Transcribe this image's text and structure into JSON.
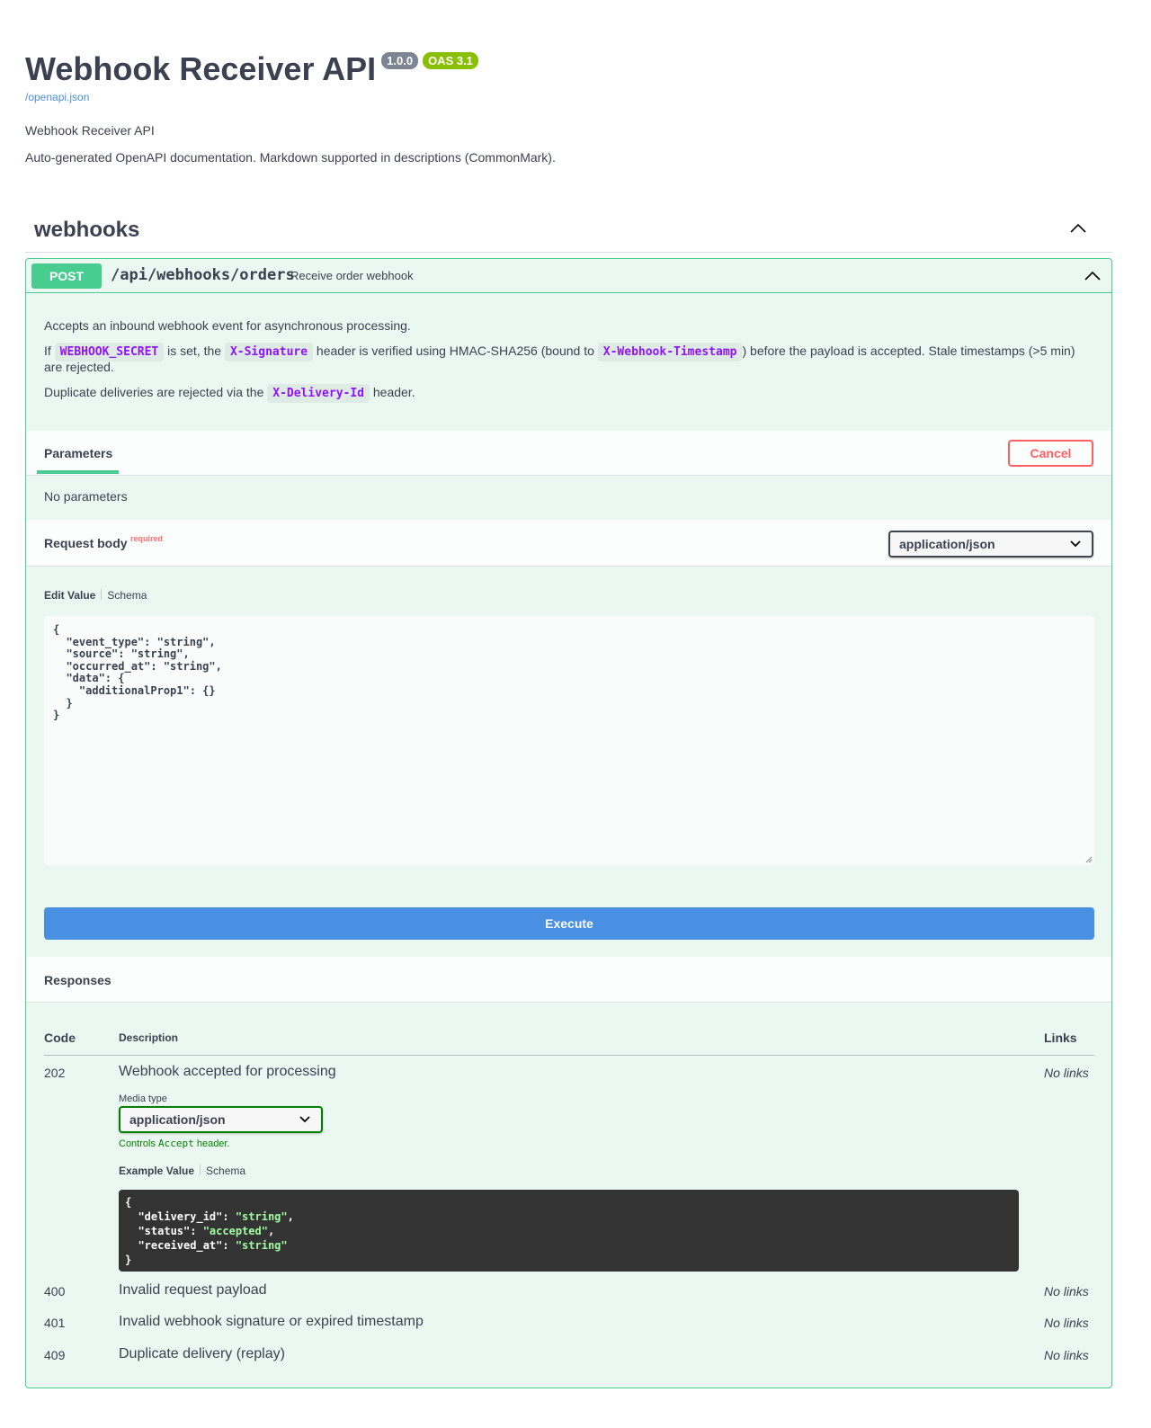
{
  "info": {
    "title": "Webhook Receiver API",
    "version": "1.0.0",
    "oas": "OAS 3.1",
    "spec_link": "/openapi.json",
    "description_1": "Webhook Receiver API",
    "description_2": "Auto-generated OpenAPI documentation. Markdown supported in descriptions (CommonMark)."
  },
  "tag": {
    "name": "webhooks",
    "chevron_icon": "chevron-up-icon"
  },
  "operation": {
    "method": "POST",
    "path": "/api/webhooks/orders",
    "summary": "Receive order webhook",
    "description": {
      "p1": "Accepts an inbound webhook event for asynchronous processing.",
      "p2_a": "If ",
      "p2_code1": "WEBHOOK_SECRET",
      "p2_b": " is set, the ",
      "p2_code2": "X-Signature",
      "p2_c": " header is verified using HMAC-SHA256 (bound to ",
      "p2_code3": "X-Webhook-Timestamp",
      "p2_d": ") before the payload is accepted. Stale timestamps (>5 min) are rejected.",
      "p3_a": "Duplicate deliveries are rejected via the ",
      "p3_code": "X-Delivery-Id",
      "p3_b": " header."
    },
    "parameters": {
      "tab_label": "Parameters",
      "cancel_label": "Cancel",
      "empty_text": "No parameters"
    },
    "request_body": {
      "title": "Request body",
      "required_label": "required",
      "content_type": "application/json",
      "tab_edit": "Edit Value",
      "tab_schema": "Schema",
      "value": "{\n  \"event_type\": \"string\",\n  \"source\": \"string\",\n  \"occurred_at\": \"string\",\n  \"data\": {\n    \"additionalProp1\": {}\n  }\n}"
    },
    "execute_label": "Execute",
    "responses": {
      "title": "Responses",
      "headers": {
        "code": "Code",
        "description": "Description",
        "links": "Links"
      },
      "media_type_label": "Media type",
      "media_type": "application/json",
      "media_hint_a": "Controls ",
      "media_hint_code": "Accept",
      "media_hint_b": " header.",
      "tab_example": "Example Value",
      "tab_schema": "Schema",
      "example": {
        "l1": "{",
        "k1": "  \"delivery_id\": ",
        "v1": "\"string\"",
        "c1": ",",
        "k2": "  \"status\": ",
        "v2": "\"accepted\"",
        "c2": ",",
        "k3": "  \"received_at\": ",
        "v3": "\"string\"",
        "l5": "}"
      },
      "rows": [
        {
          "code": "202",
          "description": "Webhook accepted for processing",
          "links": "No links"
        },
        {
          "code": "400",
          "description": "Invalid request payload",
          "links": "No links"
        },
        {
          "code": "401",
          "description": "Invalid webhook signature or expired timestamp",
          "links": "No links"
        },
        {
          "code": "409",
          "description": "Duplicate delivery (replay)",
          "links": "No links"
        }
      ]
    }
  },
  "colors": {
    "post": "#49cc90",
    "post_bg": "#eaf8f1",
    "execute": "#4990e2",
    "cancel": "#ff6060",
    "inline_code": "#9012fe",
    "link": "#4990e2"
  }
}
